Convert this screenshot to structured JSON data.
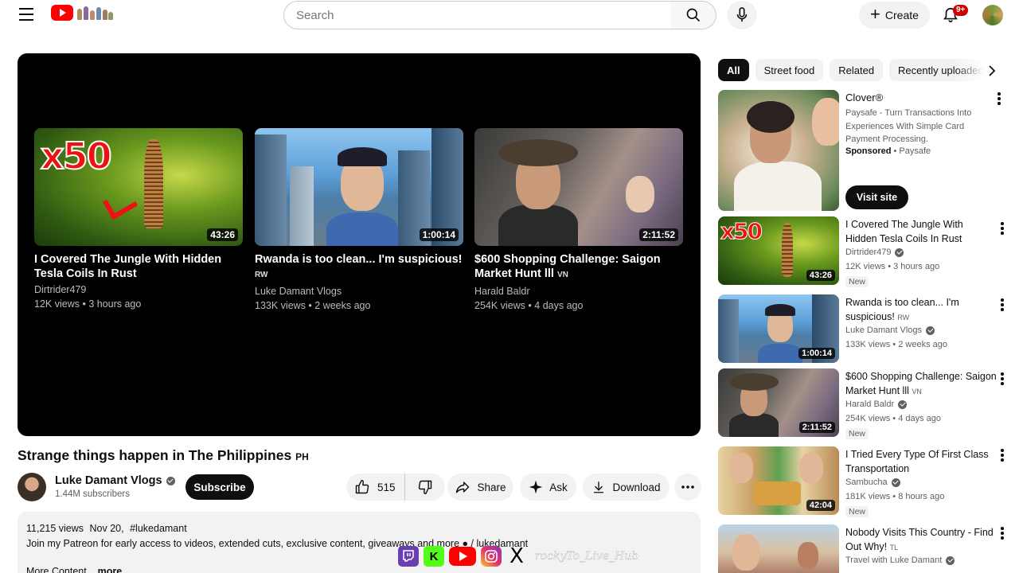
{
  "header": {
    "search_placeholder": "Search",
    "create_label": "Create",
    "notification_count": "9+"
  },
  "player": {
    "end_screen": [
      {
        "title": "I Covered The Jungle With Hidden Tesla Coils In Rust",
        "country": "",
        "channel": "Dirtrider479",
        "views": "12K views",
        "age": "3 hours ago",
        "duration": "43:26"
      },
      {
        "title": "Rwanda is too clean... I'm suspicious!",
        "country": "RW",
        "channel": "Luke Damant Vlogs",
        "views": "133K views",
        "age": "2 weeks ago",
        "duration": "1:00:14"
      },
      {
        "title": "$600 Shopping Challenge: Saigon Market Hunt lll",
        "country": "VN",
        "channel": "Harald Baldr",
        "views": "254K views",
        "age": "4 days ago",
        "duration": "2:11:52"
      }
    ]
  },
  "video": {
    "title": "Strange things happen in The Philippines",
    "country": "PH",
    "channel_name": "Luke Damant Vlogs",
    "subscribers": "1.44M subscribers",
    "subscribe_label": "Subscribe",
    "likes": "515",
    "share_label": "Share",
    "ask_label": "Ask",
    "download_label": "Download"
  },
  "description": {
    "views": "11,215 views",
    "date": "Nov 20,",
    "hashtag": "#lukedamant",
    "line2": "Join my Patreon for early access to videos, extended cuts, exclusive content, giveaways and more",
    "line2_link": "/ lukedamant",
    "line3": "More Content",
    "more_label": "...more"
  },
  "overlay": {
    "kick_letter": "K",
    "x_letter": "X",
    "script_text": "rockyTo_Live_Hub"
  },
  "sidebar": {
    "chips": [
      {
        "label": "All"
      },
      {
        "label": "Street food"
      },
      {
        "label": "Related"
      },
      {
        "label": "Recently uploaded"
      }
    ],
    "ad": {
      "title": "Clover®",
      "text": "Paysafe - Turn Transactions Into Experiences With Simple Card Payment Processing.",
      "sponsored": "Sponsored",
      "advertiser": "Paysafe",
      "cta": "Visit site"
    },
    "recommendations": [
      {
        "title": "I Covered The Jungle With Hidden Tesla Coils In Rust",
        "country": "",
        "channel": "Dirtrider479",
        "meta": "12K views • 3 hours ago",
        "badge": "New",
        "duration": "43:26"
      },
      {
        "title": "Rwanda is too clean... I'm suspicious!",
        "country": "RW",
        "channel": "Luke Damant Vlogs",
        "meta": "133K views • 2 weeks ago",
        "badge": "",
        "duration": "1:00:14"
      },
      {
        "title": "$600 Shopping Challenge: Saigon Market Hunt lll",
        "country": "VN",
        "channel": "Harald Baldr",
        "meta": "254K views • 4 days ago",
        "badge": "New",
        "duration": "2:11:52"
      },
      {
        "title": "I Tried Every Type Of First Class Transportation",
        "country": "",
        "channel": "Sambucha",
        "meta": "181K views • 8 hours ago",
        "badge": "New",
        "duration": "42:04"
      },
      {
        "title": "Nobody Visits This Country - Find Out Why!",
        "country": "TL",
        "channel": "Travel with Luke Damant",
        "meta": "",
        "badge": "",
        "duration": ""
      }
    ]
  }
}
